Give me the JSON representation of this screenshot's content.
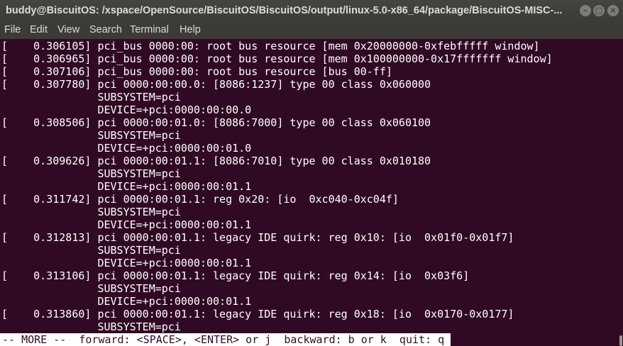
{
  "window": {
    "title": "buddy@BiscuitOS: /xspace/OpenSource/BiscuitOS/BiscuitOS/output/linux-5.0-x86_64/package/BiscuitOS-MISC-...",
    "controls": {
      "minimize_glyph": "–",
      "maximize_glyph": "□",
      "close_glyph": "×"
    }
  },
  "menubar": {
    "items": [
      "File",
      "Edit",
      "View",
      "Search",
      "Terminal",
      "Help"
    ]
  },
  "terminal": {
    "lines": [
      "[    0.306105] pci_bus 0000:00: root bus resource [mem 0x20000000-0xfebfffff window]",
      "[    0.306965] pci_bus 0000:00: root bus resource [mem 0x100000000-0x17fffffff window]",
      "[    0.307106] pci_bus 0000:00: root bus resource [bus 00-ff]",
      "[    0.307780] pci 0000:00:00.0: [8086:1237] type 00 class 0x060000",
      "               SUBSYSTEM=pci",
      "               DEVICE=+pci:0000:00:00.0",
      "[    0.308506] pci 0000:00:01.0: [8086:7000] type 00 class 0x060100",
      "               SUBSYSTEM=pci",
      "               DEVICE=+pci:0000:00:01.0",
      "[    0.309626] pci 0000:00:01.1: [8086:7010] type 00 class 0x010180",
      "               SUBSYSTEM=pci",
      "               DEVICE=+pci:0000:00:01.1",
      "[    0.311742] pci 0000:00:01.1: reg 0x20: [io  0xc040-0xc04f]",
      "               SUBSYSTEM=pci",
      "               DEVICE=+pci:0000:00:01.1",
      "[    0.312813] pci 0000:00:01.1: legacy IDE quirk: reg 0x10: [io  0x01f0-0x01f7]",
      "               SUBSYSTEM=pci",
      "               DEVICE=+pci:0000:00:01.1",
      "[    0.313106] pci 0000:00:01.1: legacy IDE quirk: reg 0x14: [io  0x03f6]",
      "               SUBSYSTEM=pci",
      "               DEVICE=+pci:0000:00:01.1",
      "[    0.313860] pci 0000:00:01.1: legacy IDE quirk: reg 0x18: [io  0x0170-0x0177]",
      "               SUBSYSTEM=pci"
    ],
    "pager_prompt": "-- MORE --  forward: <SPACE>, <ENTER> or j  backward: b or k  quit: q"
  },
  "colors": {
    "terminal_bg": "#300a24",
    "terminal_fg": "#ffffff",
    "titlebar_bg": "#3c3b37",
    "titlebar_fg": "#dfdbd2"
  }
}
